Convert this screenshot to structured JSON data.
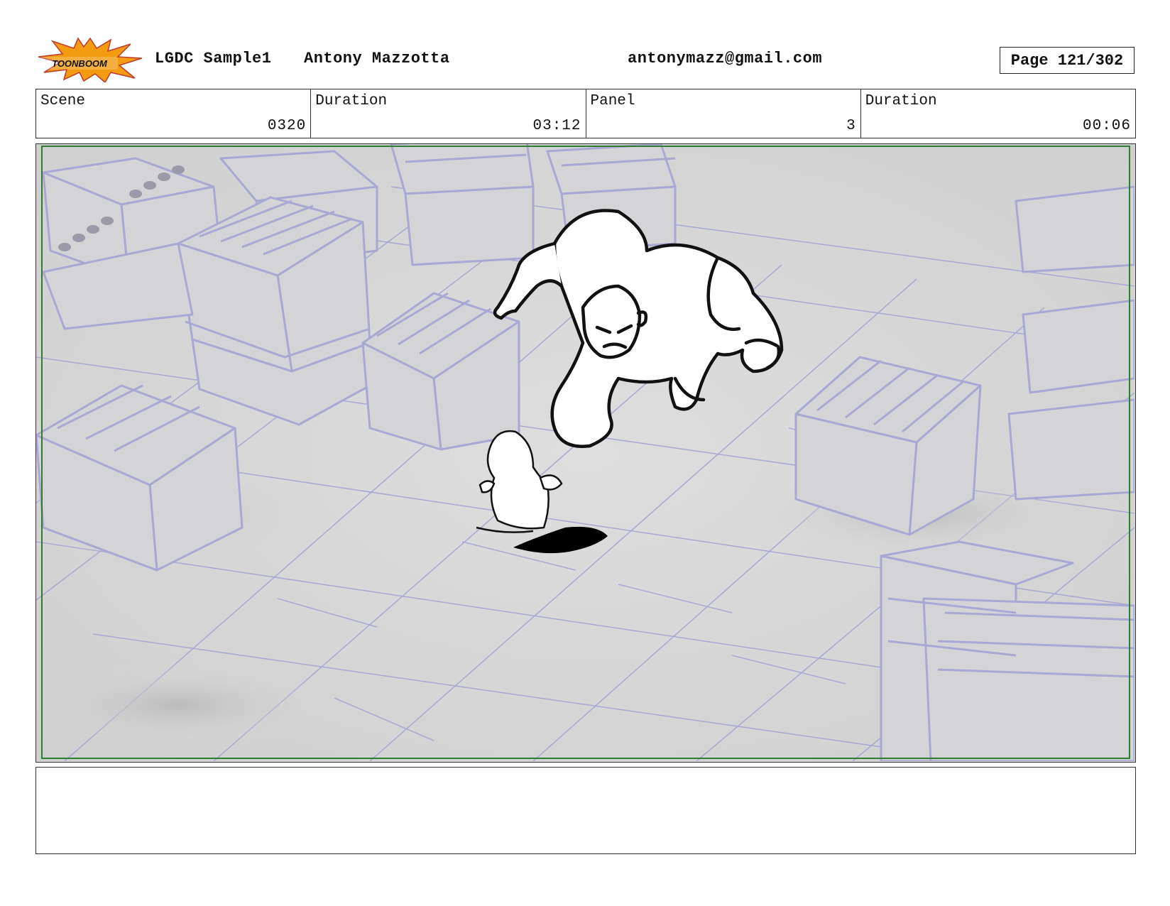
{
  "header": {
    "logo_text": "TOONBOOM",
    "project": "LGDC Sample1",
    "artist": "Antony Mazzotta",
    "email": "antonymazz@gmail.com",
    "page": "Page 121/302"
  },
  "info": {
    "scene_label": "Scene",
    "scene_value": "0320",
    "scene_duration_label": "Duration",
    "scene_duration_value": "03:12",
    "panel_label": "Panel",
    "panel_value": "3",
    "panel_duration_label": "Duration",
    "panel_duration_value": "00:06"
  },
  "colors": {
    "crate_line": "#a7a9d2",
    "background": "#d9d9d9",
    "safe_frame": "#2e7d32",
    "logo_orange": "#f39c12"
  },
  "notes": {
    "text": ""
  }
}
